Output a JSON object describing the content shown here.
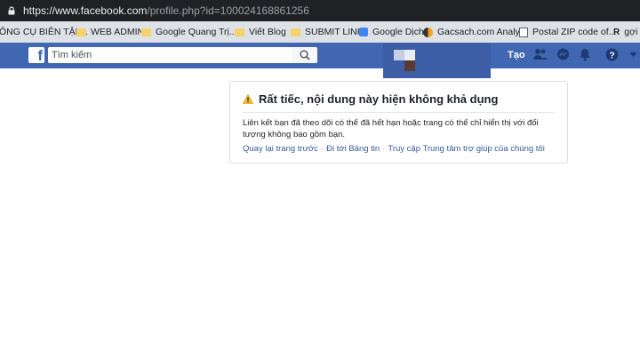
{
  "browser": {
    "url_host": "https://www.facebook.com",
    "url_path": "/profile.php?id=100024168861256"
  },
  "bookmarks": [
    {
      "label": "ÔNG CỤ BIÊN TẬP...",
      "icon": "none"
    },
    {
      "label": "WEB ADMIN",
      "icon": "folder-icon"
    },
    {
      "label": "Google Quang Trị...",
      "icon": "folder-icon"
    },
    {
      "label": "Viết Blog",
      "icon": "folder-icon"
    },
    {
      "label": "SUBMIT LINK",
      "icon": "folder-icon"
    },
    {
      "label": "Google Dịch",
      "icon": "translate-icon"
    },
    {
      "label": "Gacsach.com Analy...",
      "icon": "analytics-icon"
    },
    {
      "label": "Postal ZIP code of...",
      "icon": "page-icon"
    },
    {
      "label": "gợi ý",
      "icon": "r-icon"
    }
  ],
  "fb": {
    "logo": "f",
    "search_placeholder": "Tìm kiếm",
    "create_label": "Tạo",
    "accent": "#4267b2"
  },
  "notice": {
    "title": "Rất tiếc, nội dung này hiện không khả dụng",
    "message": "Liên kết bạn đã theo dõi có thể đã hết hạn hoặc trang có thể chỉ hiển thị với đối tượng không bao gồm bạn.",
    "links": [
      "Quay lại trang trước",
      "Đi tới Bảng tin",
      "Truy cập Trung tâm trợ giúp của chúng tôi"
    ],
    "separator": "·"
  }
}
